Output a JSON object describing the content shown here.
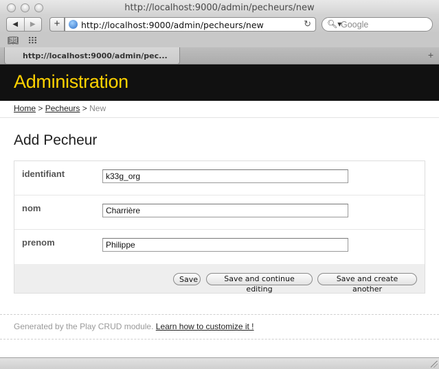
{
  "browser": {
    "window_title": "http://localhost:9000/admin/pecheurs/new",
    "url": "http://localhost:9000/admin/pecheurs/new",
    "search_placeholder": "Google",
    "tab_label": "http://localhost:9000/admin/pec...",
    "icons": {
      "back": "back-arrow-icon",
      "forward": "forward-arrow-icon",
      "add_bookmark": "plus-icon",
      "site": "globe-icon",
      "reload": "reload-icon",
      "search": "search-icon",
      "bookmarks": "book-icon",
      "top_sites": "grid-icon",
      "new_tab": "plus-icon"
    }
  },
  "header": {
    "title": "Administration",
    "title_color": "#ffd200",
    "background": "#111111"
  },
  "breadcrumb": {
    "home": "Home",
    "pecheurs": "Pecheurs",
    "separator": ">",
    "current": "New"
  },
  "page": {
    "title": "Add Pecheur"
  },
  "form": {
    "fields": [
      {
        "label": "identifiant",
        "value": "k33g_org"
      },
      {
        "label": "nom",
        "value": "Charrière"
      },
      {
        "label": "prenom",
        "value": "Philippe"
      }
    ],
    "actions": {
      "save": "Save",
      "save_continue": "Save and continue editing",
      "save_another": "Save and create another"
    }
  },
  "footer": {
    "text": "Generated by the Play CRUD module.",
    "link": "Learn how to customize it !"
  }
}
